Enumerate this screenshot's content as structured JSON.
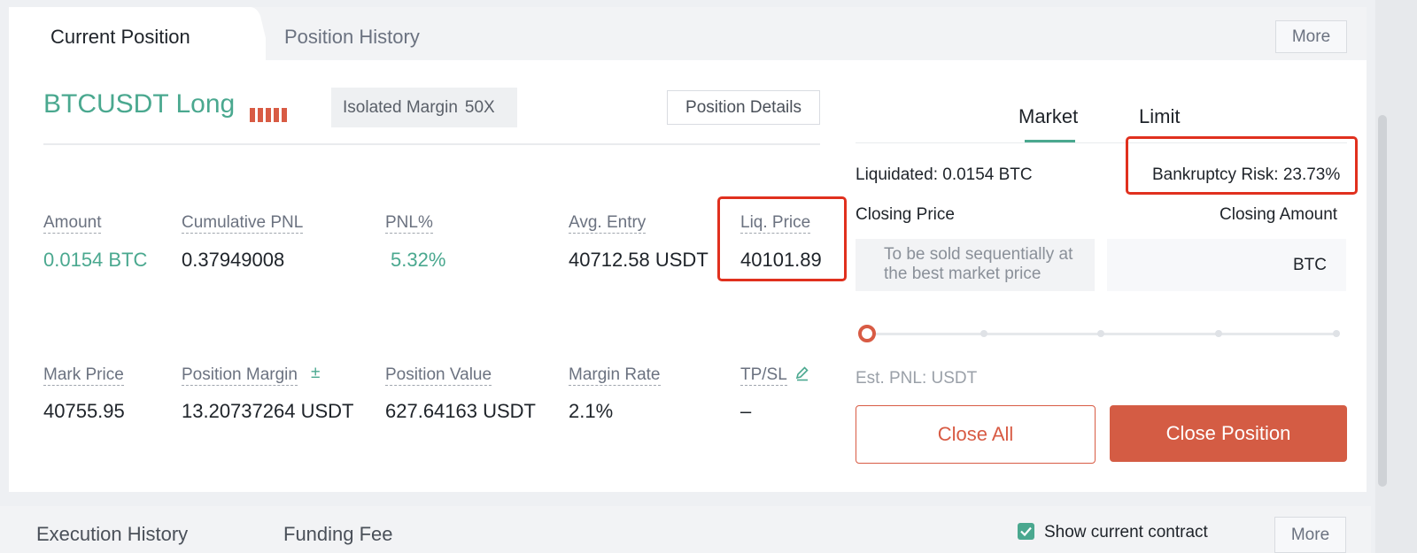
{
  "tabs": {
    "active": "Current Position",
    "inactive": "Position History",
    "more": "More"
  },
  "position": {
    "symbol": "BTCUSDT Long",
    "margin_mode": "Isolated Margin",
    "leverage": "50X",
    "details_button": "Position Details"
  },
  "fields": {
    "amount": {
      "label": "Amount",
      "value": "0.0154 BTC"
    },
    "cumulative_pnl": {
      "label": "Cumulative PNL",
      "value": "0.37949008"
    },
    "pnl_pct": {
      "label": "PNL%",
      "value": "5.32%"
    },
    "avg_entry": {
      "label": "Avg. Entry",
      "value": "40712.58 USDT"
    },
    "liq_price": {
      "label": "Liq. Price",
      "value": "40101.89"
    },
    "mark_price": {
      "label": "Mark Price",
      "value": "40755.95"
    },
    "position_margin": {
      "label": "Position Margin",
      "suffix": "±",
      "value": "13.20737264 USDT"
    },
    "position_value": {
      "label": "Position Value",
      "value": "627.64163 USDT"
    },
    "margin_rate": {
      "label": "Margin Rate",
      "value": "2.1%"
    },
    "tp_sl": {
      "label": "TP/SL",
      "value": "–"
    }
  },
  "close_panel": {
    "tabs": {
      "market": "Market",
      "limit": "Limit"
    },
    "liquidated": "Liquidated: 0.0154 BTC",
    "bankruptcy_risk": "Bankruptcy Risk: 23.73%",
    "closing_price_label": "Closing Price",
    "closing_amount_label": "Closing Amount",
    "closing_price_text": "To be sold sequentially at the best market price",
    "closing_amount_unit": "BTC",
    "slider_value": 0,
    "est_pnl": "Est. PNL: USDT",
    "close_all": "Close All",
    "close_position": "Close Position"
  },
  "bottom": {
    "tab1": "Execution History",
    "tab2": "Funding Fee",
    "checkbox_label": "Show current contract",
    "checkbox_checked": true,
    "more": "More"
  },
  "colors": {
    "accent_green": "#4aa88f",
    "accent_red": "#d45c44",
    "highlight_red": "#e0301e"
  },
  "icons": {
    "edit": "pencil-icon",
    "check": "check-icon"
  }
}
